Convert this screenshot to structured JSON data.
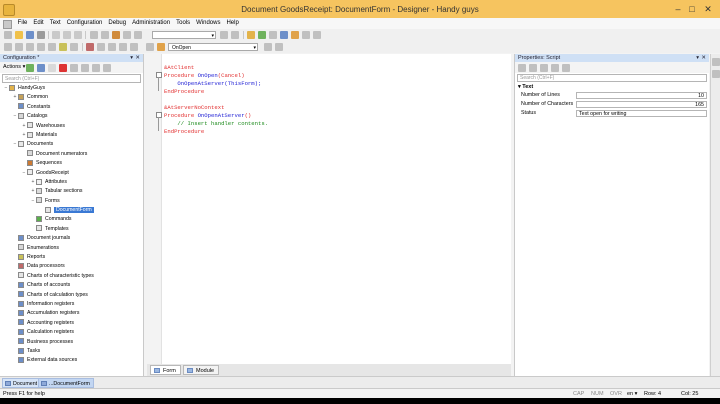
{
  "window": {
    "title": "Document GoodsReceipt: DocumentForm - Designer - Handy guys"
  },
  "menu": [
    "File",
    "Edit",
    "Text",
    "Configuration",
    "Debug",
    "Administration",
    "Tools",
    "Windows",
    "Help"
  ],
  "toolbar2": {
    "form_combo": "OnOpen"
  },
  "config_panel": {
    "title": "Configuration *",
    "actions_label": "Actions ▾",
    "search_placeholder": "Search (Ctrl+F)",
    "tree": [
      {
        "label": "HandyGuys",
        "indent": 0,
        "exp": "−",
        "icon": "config-icon",
        "color": "#e3b34a"
      },
      {
        "label": "Common",
        "indent": 1,
        "exp": "+",
        "icon": "common-icon",
        "color": "#c4a15a"
      },
      {
        "label": "Constants",
        "indent": 1,
        "exp": "",
        "icon": "constants-icon",
        "color": "#6d8fc9"
      },
      {
        "label": "Catalogs",
        "indent": 1,
        "exp": "−",
        "icon": "catalog-icon",
        "color": "#d7d7d7"
      },
      {
        "label": "Warehouses",
        "indent": 2,
        "exp": "+",
        "icon": "catalog-item-icon",
        "color": "#e6e6e6"
      },
      {
        "label": "Materials",
        "indent": 2,
        "exp": "+",
        "icon": "catalog-item-icon",
        "color": "#e6e6e6"
      },
      {
        "label": "Documents",
        "indent": 1,
        "exp": "−",
        "icon": "documents-icon",
        "color": "#e9e9e9"
      },
      {
        "label": "Document numerators",
        "indent": 2,
        "exp": "",
        "icon": "numerator-icon",
        "color": "#d9d9d9"
      },
      {
        "label": "Sequences",
        "indent": 2,
        "exp": "",
        "icon": "sequence-icon",
        "color": "#cc7a33"
      },
      {
        "label": "GoodsReceipt",
        "indent": 2,
        "exp": "−",
        "icon": "document-icon",
        "color": "#ececec"
      },
      {
        "label": "Attributes",
        "indent": 3,
        "exp": "+",
        "icon": "attributes-icon",
        "color": "#f0f0f0"
      },
      {
        "label": "Tabular sections",
        "indent": 3,
        "exp": "+",
        "icon": "tabular-icon",
        "color": "#dcdcdc"
      },
      {
        "label": "Forms",
        "indent": 3,
        "exp": "−",
        "icon": "forms-icon",
        "color": "#dcdcdc"
      },
      {
        "label": "DocumentForm",
        "indent": 4,
        "exp": "",
        "icon": "form-icon",
        "color": "#e5e5e5",
        "selected": true
      },
      {
        "label": "Commands",
        "indent": 3,
        "exp": "",
        "icon": "commands-icon",
        "color": "#5bb04c"
      },
      {
        "label": "Templates",
        "indent": 3,
        "exp": "",
        "icon": "templates-icon",
        "color": "#e6e6e6"
      },
      {
        "label": "Document journals",
        "indent": 1,
        "exp": "",
        "icon": "journal-icon",
        "color": "#6d8fc9"
      },
      {
        "label": "Enumerations",
        "indent": 1,
        "exp": "",
        "icon": "enum-icon",
        "color": "#d7d7d7"
      },
      {
        "label": "Reports",
        "indent": 1,
        "exp": "",
        "icon": "report-icon",
        "color": "#c9c15a"
      },
      {
        "label": "Data processors",
        "indent": 1,
        "exp": "",
        "icon": "processor-icon",
        "color": "#c06a6a"
      },
      {
        "label": "Charts of characteristic types",
        "indent": 1,
        "exp": "",
        "icon": "chart-char-icon",
        "color": "#e6e6e6"
      },
      {
        "label": "Charts of accounts",
        "indent": 1,
        "exp": "",
        "icon": "chart-accounts-icon",
        "color": "#6d8fc9"
      },
      {
        "label": "Charts of calculation types",
        "indent": 1,
        "exp": "",
        "icon": "chart-calc-icon",
        "color": "#6d8fc9"
      },
      {
        "label": "Information registers",
        "indent": 1,
        "exp": "",
        "icon": "info-register-icon",
        "color": "#6d8fc9"
      },
      {
        "label": "Accumulation registers",
        "indent": 1,
        "exp": "",
        "icon": "accum-register-icon",
        "color": "#6d8fc9"
      },
      {
        "label": "Accounting registers",
        "indent": 1,
        "exp": "",
        "icon": "accounting-register-icon",
        "color": "#6d8fc9"
      },
      {
        "label": "Calculation registers",
        "indent": 1,
        "exp": "",
        "icon": "calc-register-icon",
        "color": "#6d8fc9"
      },
      {
        "label": "Business processes",
        "indent": 1,
        "exp": "",
        "icon": "business-process-icon",
        "color": "#6d8fc9"
      },
      {
        "label": "Tasks",
        "indent": 1,
        "exp": "",
        "icon": "tasks-icon",
        "color": "#6d8fc9"
      },
      {
        "label": "External data sources",
        "indent": 1,
        "exp": "",
        "icon": "external-source-icon",
        "color": "#6d8fc9"
      }
    ]
  },
  "editor": {
    "lines": [
      {
        "tokens": [
          {
            "t": "&AtClient",
            "c": "kw"
          }
        ]
      },
      {
        "tokens": [
          {
            "t": "Procedure ",
            "c": "kw"
          },
          {
            "t": "OnOpen",
            "c": "fn"
          },
          {
            "t": "(Cancel)",
            "c": "kw"
          }
        ]
      },
      {
        "tokens": [
          {
            "t": "    OnOpenAtServer(ThisForm);",
            "c": "fn"
          }
        ]
      },
      {
        "tokens": [
          {
            "t": "EndProcedure",
            "c": "kw"
          }
        ]
      },
      {
        "tokens": []
      },
      {
        "tokens": [
          {
            "t": "&AtServerNoContext",
            "c": "kw"
          }
        ]
      },
      {
        "tokens": [
          {
            "t": "Procedure ",
            "c": "kw"
          },
          {
            "t": "OnOpenAtServer",
            "c": "fn"
          },
          {
            "t": "()",
            "c": "kw"
          }
        ]
      },
      {
        "tokens": [
          {
            "t": "    // Insert handler contents.",
            "c": "cm"
          }
        ]
      },
      {
        "tokens": [
          {
            "t": "EndProcedure",
            "c": "kw"
          }
        ]
      }
    ]
  },
  "tabs": [
    {
      "label": "Form",
      "active": true
    },
    {
      "label": "Module",
      "active": false
    }
  ],
  "properties": {
    "title": "Properties: Script",
    "search_placeholder": "Search (Ctrl+F)",
    "group": "Text",
    "rows": [
      {
        "label": "Number of Lines",
        "value": "10",
        "num": true
      },
      {
        "label": "Number of Characters",
        "value": "165",
        "num": true
      },
      {
        "label": "Status",
        "value": "Text open for writing",
        "num": false
      }
    ]
  },
  "window_tabs": [
    {
      "label": "Document G...",
      "active": false
    },
    {
      "label": "...DocumentForm",
      "active": true
    }
  ],
  "status": {
    "help": "Press F1 for help",
    "cap": "CAP",
    "num": "NUM",
    "ovr": "OVR",
    "lang": "en ▾",
    "row": "Row: 4",
    "col": "Col: 25"
  }
}
